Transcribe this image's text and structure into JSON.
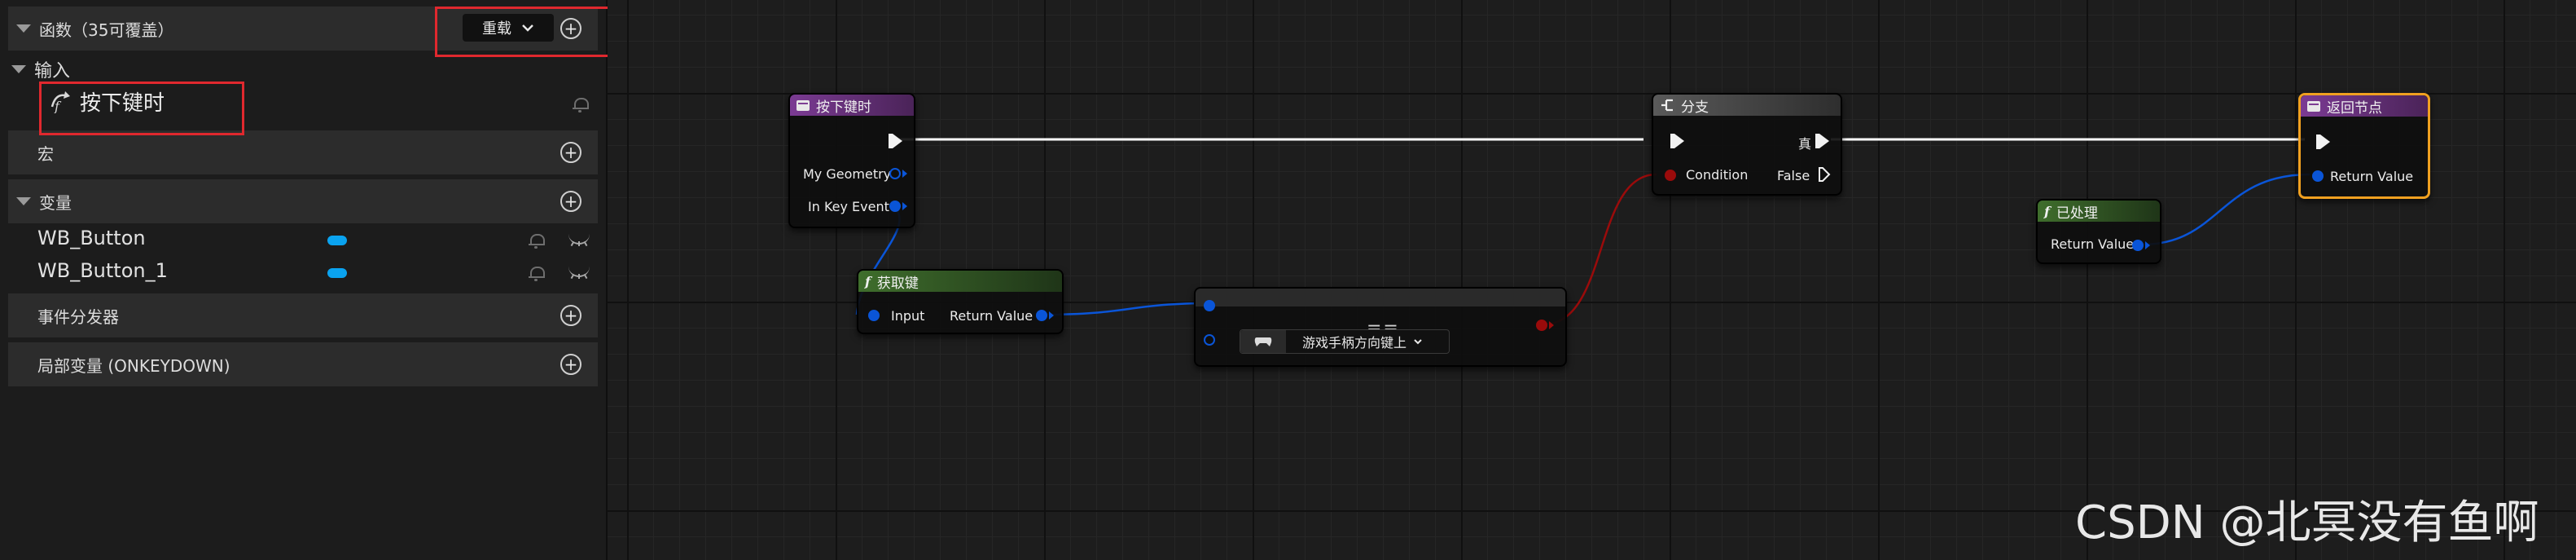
{
  "panel": {
    "functions": {
      "label": "函数（35可覆盖）",
      "override_label": "重载"
    },
    "inputs": {
      "label": "输入",
      "item_label": "按下键时"
    },
    "macros": {
      "label": "宏"
    },
    "variables": {
      "label": "变量",
      "items": [
        {
          "name": "WB_Button"
        },
        {
          "name": "WB_Button_1"
        }
      ]
    },
    "dispatchers": {
      "label": "事件分发器"
    },
    "locals": {
      "label": "局部变量 (ONKEYDOWN)"
    }
  },
  "graph": {
    "node_on_key_down": {
      "title": "按下键时",
      "pins": [
        "My Geometry",
        "In Key Event"
      ]
    },
    "node_get_key": {
      "title": "获取键",
      "input": "Input",
      "output": "Return Value"
    },
    "node_equal": {
      "title": "==",
      "value": "游戏手柄方向键上"
    },
    "node_branch": {
      "title": "分支",
      "condition": "Condition",
      "true_label": "真",
      "false_label": "False"
    },
    "node_handled": {
      "title": "已处理",
      "output": "Return Value"
    },
    "node_return": {
      "title": "返回节点",
      "input": "Return Value"
    }
  },
  "watermark": "CSDN @北冥没有鱼啊",
  "colors": {
    "event_header": "#7b3b93",
    "function_header": "#3f6e2c",
    "struct_pin": "#0a55d8",
    "bool_pin": "#9a0b0b",
    "highlight": "#e0282e",
    "selection": "#f0a020"
  }
}
